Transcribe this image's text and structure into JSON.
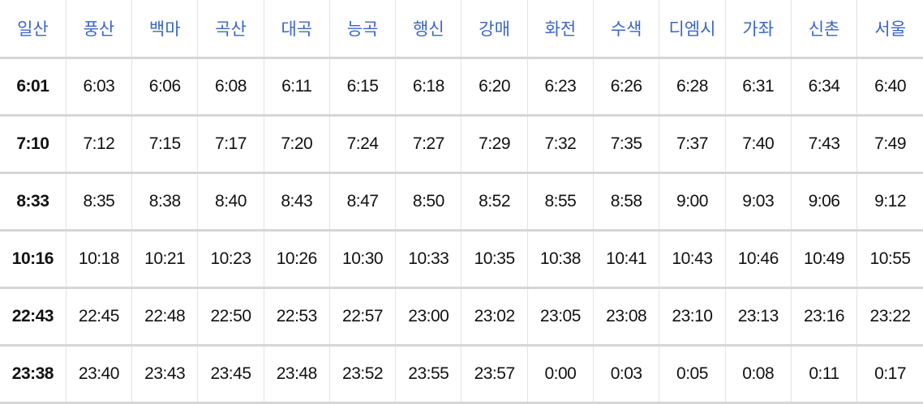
{
  "stations": [
    "일산",
    "풍산",
    "백마",
    "곡산",
    "대곡",
    "능곡",
    "행신",
    "강매",
    "화전",
    "수색",
    "디엠시",
    "가좌",
    "신촌",
    "서울"
  ],
  "rows": [
    [
      "6:01",
      "6:03",
      "6:06",
      "6:08",
      "6:11",
      "6:15",
      "6:18",
      "6:20",
      "6:23",
      "6:26",
      "6:28",
      "6:31",
      "6:34",
      "6:40"
    ],
    [
      "7:10",
      "7:12",
      "7:15",
      "7:17",
      "7:20",
      "7:24",
      "7:27",
      "7:29",
      "7:32",
      "7:35",
      "7:37",
      "7:40",
      "7:43",
      "7:49"
    ],
    [
      "8:33",
      "8:35",
      "8:38",
      "8:40",
      "8:43",
      "8:47",
      "8:50",
      "8:52",
      "8:55",
      "8:58",
      "9:00",
      "9:03",
      "9:06",
      "9:12"
    ],
    [
      "10:16",
      "10:18",
      "10:21",
      "10:23",
      "10:26",
      "10:30",
      "10:33",
      "10:35",
      "10:38",
      "10:41",
      "10:43",
      "10:46",
      "10:49",
      "10:55"
    ],
    [
      "22:43",
      "22:45",
      "22:48",
      "22:50",
      "22:53",
      "22:57",
      "23:00",
      "23:02",
      "23:05",
      "23:08",
      "23:10",
      "23:13",
      "23:16",
      "23:22"
    ],
    [
      "23:38",
      "23:40",
      "23:43",
      "23:45",
      "23:48",
      "23:52",
      "23:55",
      "23:57",
      "0:00",
      "0:03",
      "0:05",
      "0:08",
      "0:11",
      "0:17"
    ]
  ],
  "colors": {
    "header_text": "#3a66c4",
    "cell_text": "#111111",
    "row_border": "#d6d6d6",
    "column_border": "#e3e3e3"
  }
}
